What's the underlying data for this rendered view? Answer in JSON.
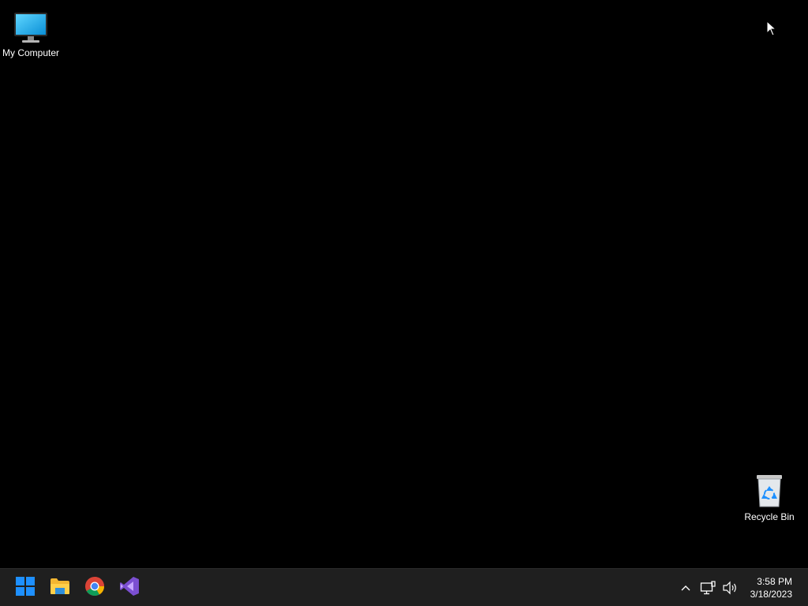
{
  "desktop": {
    "icons": [
      {
        "label": "My Computer",
        "icon": "monitor-icon"
      },
      {
        "label": "Recycle Bin",
        "icon": "recycle-bin-icon"
      }
    ]
  },
  "taskbar": {
    "pinned": [
      {
        "name": "Start",
        "icon": "windows-logo-icon"
      },
      {
        "name": "File Explorer",
        "icon": "folder-icon"
      },
      {
        "name": "Google Chrome",
        "icon": "chrome-icon"
      },
      {
        "name": "Visual Studio",
        "icon": "visual-studio-icon"
      }
    ],
    "tray": {
      "icons": [
        "chevron-up-icon",
        "network-icon",
        "volume-icon"
      ],
      "time": "3:58 PM",
      "date": "3/18/2023"
    },
    "colors": {
      "background": "#1f1f1f",
      "start_blue": "#1e90ff"
    }
  }
}
